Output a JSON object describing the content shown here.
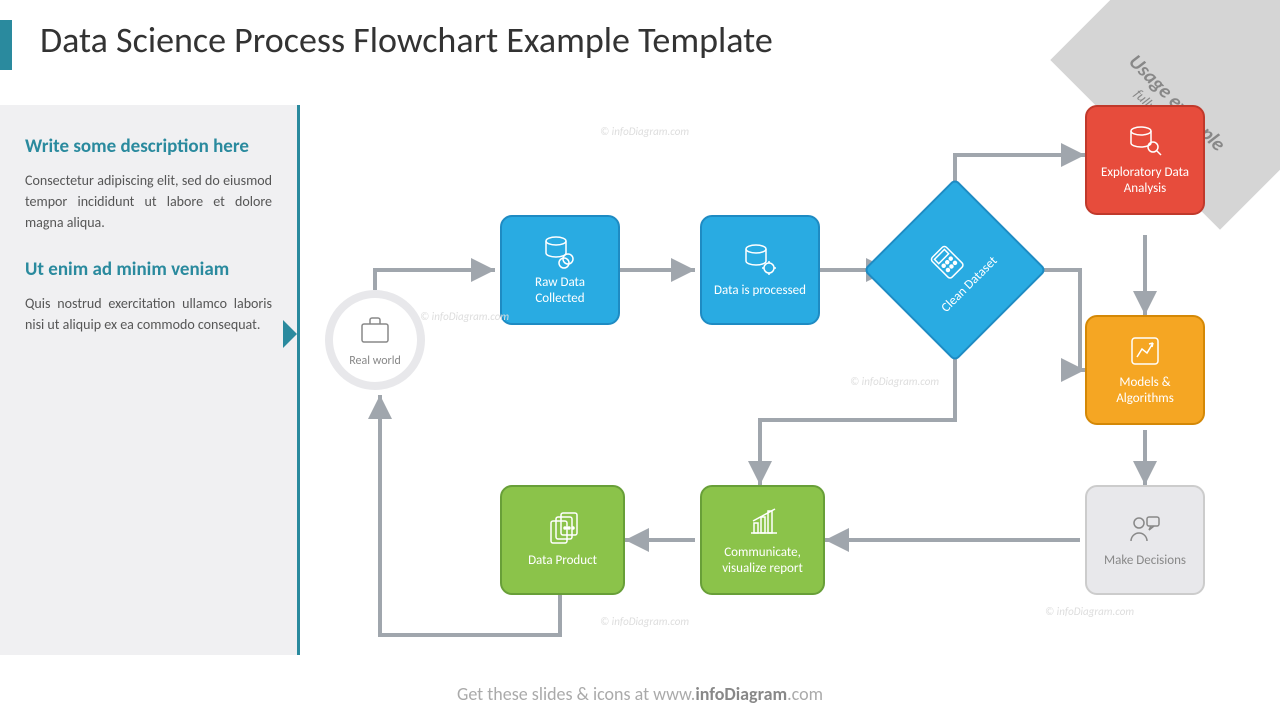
{
  "title": "Data Science Process Flowchart Example Template",
  "ribbon": {
    "line1": "Usage example",
    "line2": "fully editable"
  },
  "sidebar": {
    "heading1": "Write some description here",
    "para1": "Consectetur adipiscing elit, sed do eiusmod tempor incididunt ut labore et dolore magna aliqua.",
    "heading2": "Ut enim ad minim veniam",
    "para2": "Quis nostrud exercitation ullamco laboris nisi ut aliquip ex ea commodo consequat."
  },
  "nodes": {
    "start": "Real world",
    "raw": "Raw Data Collected",
    "processed": "Data is processed",
    "clean": "Clean Dataset",
    "eda": "Exploratory Data Analysis",
    "models": "Models & Algorithms",
    "decisions": "Make Decisions",
    "communicate": "Communicate, visualize report",
    "product": "Data Product"
  },
  "footer": {
    "pre": "Get these slides & icons at www.",
    "bold": "infoDiagram",
    "post": ".com"
  },
  "watermark": "© infoDiagram.com",
  "colors": {
    "blue": "#29abe2",
    "red": "#e74c3c",
    "orange": "#f5a623",
    "green": "#8bc34a",
    "grey": "#e8e8eb",
    "teal": "#2a8a9e"
  }
}
